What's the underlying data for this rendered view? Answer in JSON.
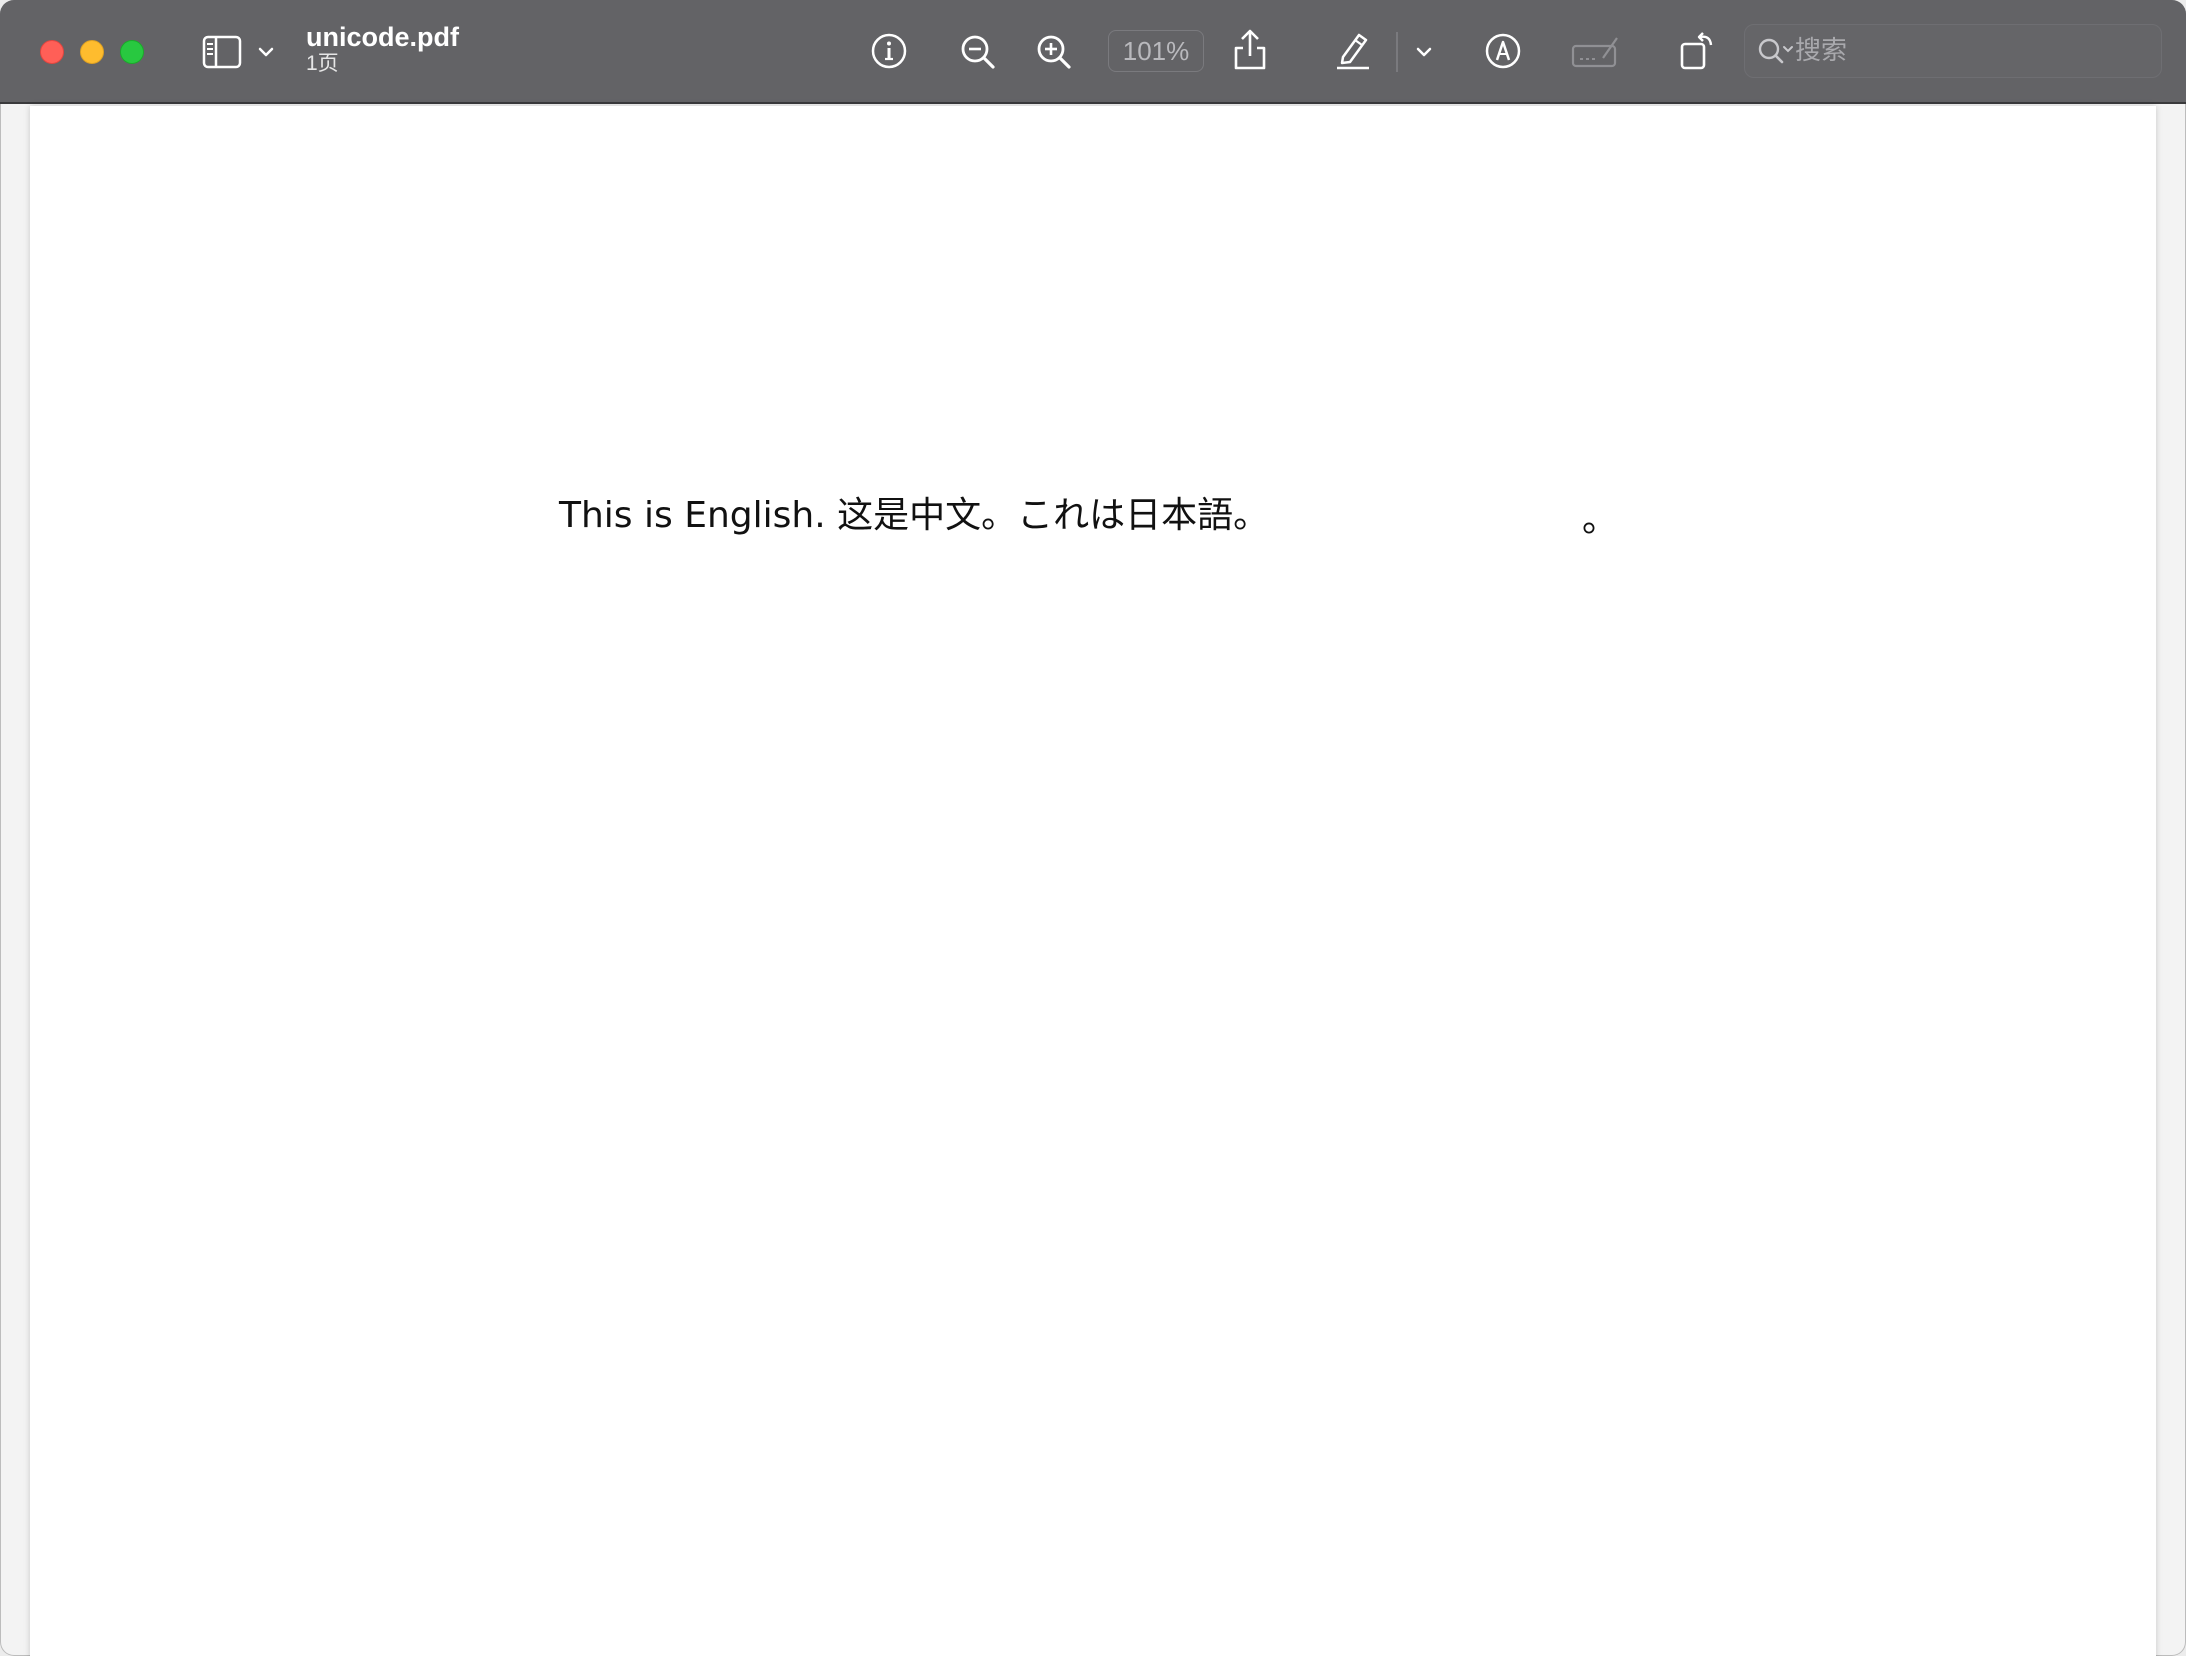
{
  "window": {
    "title": "unicode.pdf",
    "subtitle": "1页"
  },
  "toolbar": {
    "zoom_level": "101%",
    "search_placeholder": "搜索",
    "icons": {
      "sidebar": "sidebar-icon",
      "sidebar_menu": "chevron-down-icon",
      "info": "info-icon",
      "zoom_out": "zoom-out-icon",
      "zoom_in": "zoom-in-icon",
      "share": "share-icon",
      "highlight": "highlighter-icon",
      "highlight_menu": "chevron-down-icon",
      "markup": "markup-icon",
      "form_fill": "form-fill-icon",
      "rotate": "rotate-icon",
      "search": "search-icon"
    }
  },
  "document": {
    "line1": "This is English. 这是中文。これは日本語。",
    "trailing_mark": "。"
  },
  "colors": {
    "toolbar_bg": "#636366",
    "close": "#ff5f57",
    "minimize": "#febc2e",
    "maximize": "#28c840",
    "page_bg": "#ffffff"
  }
}
